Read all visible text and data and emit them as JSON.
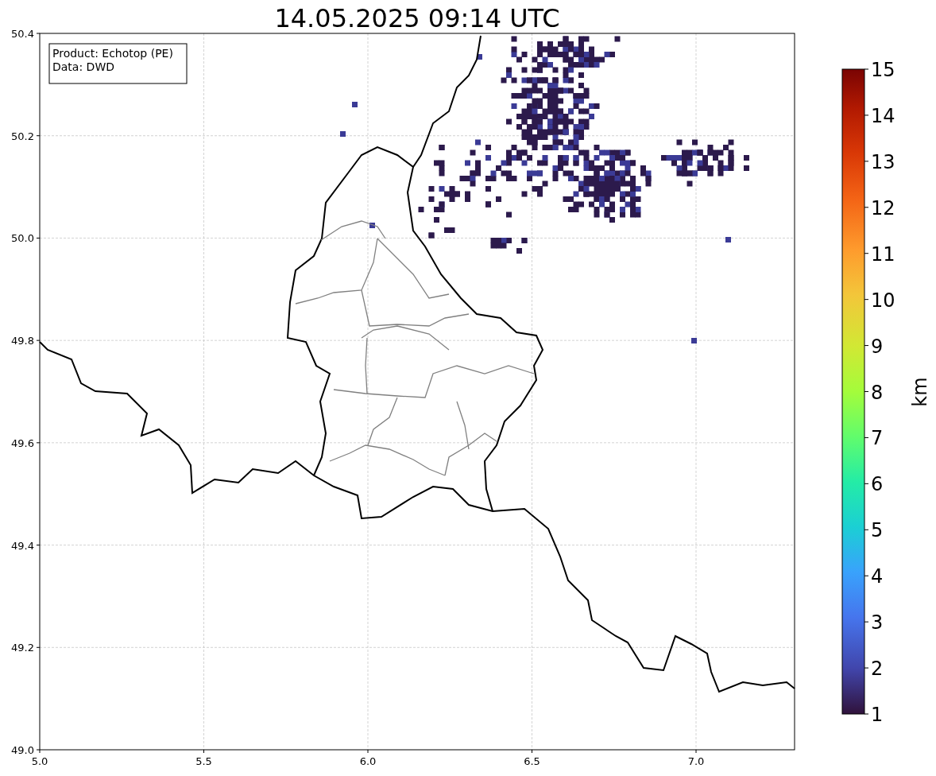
{
  "title": "14.05.2025 09:14 UTC",
  "info_box": {
    "lines": [
      "Product: Echotop (PE)",
      "Data: DWD"
    ]
  },
  "x_axis": {
    "ticks": [
      "5.0",
      "5.5",
      "6.0",
      "6.5",
      "7.0"
    ]
  },
  "y_axis": {
    "ticks": [
      "50.4",
      "50.2",
      "50.0",
      "49.8",
      "49.6",
      "49.4",
      "49.2",
      "49.0"
    ]
  },
  "colorbar": {
    "label": "km",
    "ticks": [
      "15",
      "14",
      "13",
      "12",
      "11",
      "10",
      "9",
      "8",
      "7",
      "6",
      "5",
      "4",
      "3",
      "2",
      "1"
    ]
  }
}
